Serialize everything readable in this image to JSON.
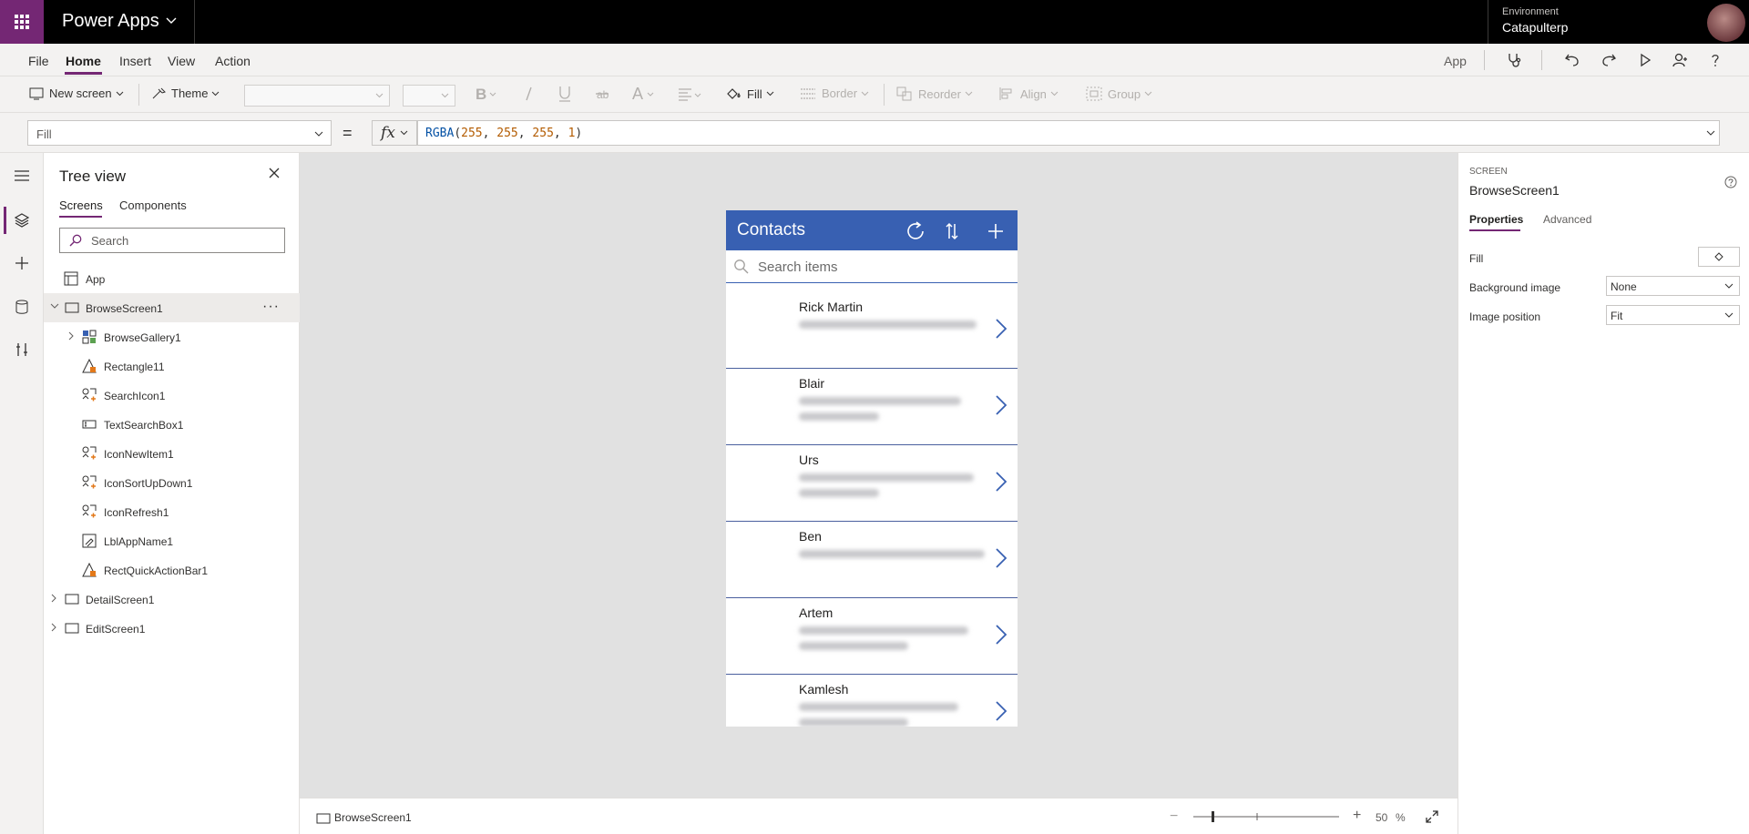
{
  "topbar": {
    "app_name": "Power Apps",
    "environment_label": "Environment",
    "environment_name": "Catapulterp"
  },
  "menu": {
    "items": [
      "File",
      "Home",
      "Insert",
      "View",
      "Action"
    ],
    "active": "Home",
    "app_label": "App"
  },
  "ribbon": {
    "new_screen": "New screen",
    "theme": "Theme",
    "fill": "Fill",
    "border": "Border",
    "reorder": "Reorder",
    "align": "Align",
    "group": "Group"
  },
  "formula_bar": {
    "property": "Fill",
    "equals": "=",
    "fx": "fx",
    "formula": {
      "fn": "RGBA",
      "open": "(",
      "args": [
        "255",
        "255",
        "255",
        "1"
      ],
      "sep": ", ",
      "close": ")"
    }
  },
  "tree": {
    "title": "Tree view",
    "tabs": [
      "Screens",
      "Components"
    ],
    "search_placeholder": "Search",
    "app_item": "App",
    "items": [
      "BrowseScreen1",
      "BrowseGallery1",
      "Rectangle11",
      "SearchIcon1",
      "TextSearchBox1",
      "IconNewItem1",
      "IconSortUpDown1",
      "IconRefresh1",
      "LblAppName1",
      "RectQuickActionBar1",
      "DetailScreen1",
      "EditScreen1"
    ],
    "selected": "BrowseScreen1"
  },
  "phone": {
    "title": "Contacts",
    "search_placeholder": "Search items",
    "contacts": [
      "Rick Martin",
      "Blair",
      "Urs",
      "Ben",
      "Artem",
      "Kamlesh"
    ]
  },
  "status_bar": {
    "screen": "BrowseScreen1",
    "minus": "−",
    "plus": "+",
    "zoom": "50",
    "zoom_unit": "%",
    "zoom_level": 0.5
  },
  "properties": {
    "kind": "SCREEN",
    "name": "BrowseScreen1",
    "tabs": [
      "Properties",
      "Advanced"
    ],
    "fill_label": "Fill",
    "background_image_label": "Background image",
    "background_image_value": "None",
    "image_position_label": "Image position",
    "image_position_value": "Fit"
  },
  "colors": {
    "brand": "#742774",
    "header": "#3860b2",
    "canvas": "#e1e1e1"
  }
}
